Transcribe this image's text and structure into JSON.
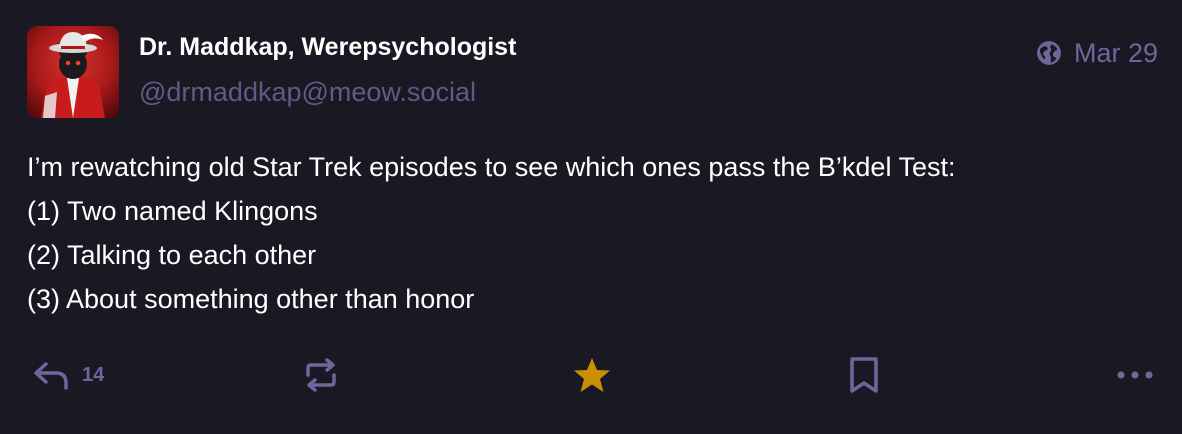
{
  "post": {
    "author": {
      "display_name": "Dr. Maddkap, Werepsychologist",
      "handle": "@drmaddkap@meow.social"
    },
    "visibility_icon": "globe-icon",
    "date": "Mar 29",
    "content_lines": [
      "I’m rewatching old Star Trek episodes to see which ones pass the B’kdel Test:",
      "(1) Two named Klingons",
      "(2) Talking to each other",
      "(3) About something other than honor"
    ],
    "actions": {
      "reply": {
        "icon": "reply-icon",
        "count": "14"
      },
      "boost": {
        "icon": "boost-icon"
      },
      "favourite": {
        "icon": "star-icon",
        "active": true,
        "color": "#ca8f04"
      },
      "bookmark": {
        "icon": "bookmark-icon"
      },
      "more": {
        "icon": "ellipsis-icon"
      }
    }
  },
  "colors": {
    "background": "#191823",
    "text": "#ffffff",
    "muted": "#6c689b",
    "handle": "#5f5b84",
    "accent_star": "#ca8f04"
  }
}
